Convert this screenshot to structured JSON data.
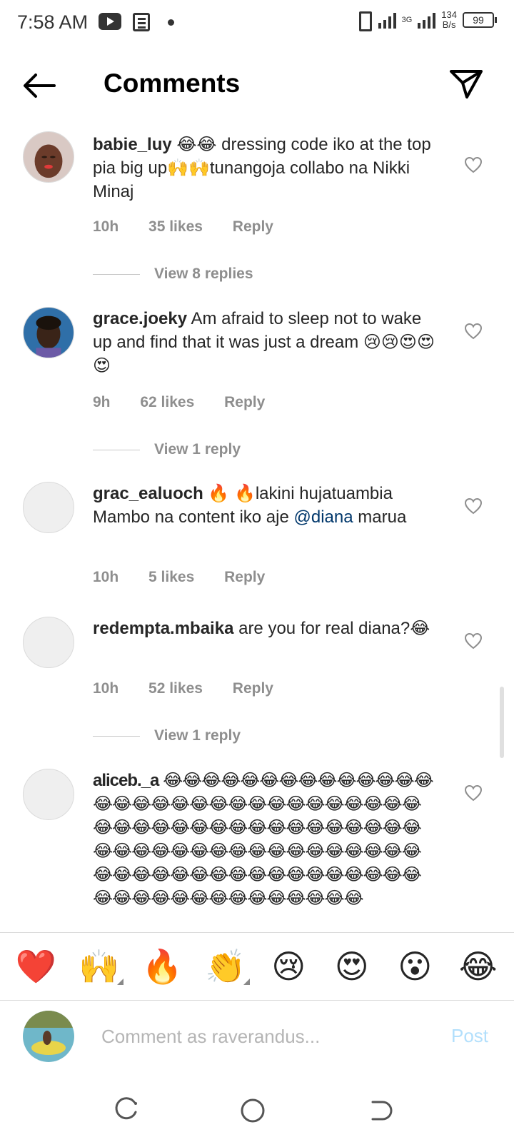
{
  "status_bar": {
    "time": "7:58 AM",
    "network": "3G",
    "speed_value": "134",
    "speed_unit": "B/s",
    "battery": "99"
  },
  "header": {
    "title": "Comments",
    "back_icon": "arrow-left-icon",
    "send_icon": "paper-plane-icon"
  },
  "comments": [
    {
      "username": "babie_luy",
      "text": "😂😂 dressing code iko at the top pia big up🙌🙌tunangoja collabo na Nikki Minaj",
      "time": "10h",
      "likes": "35 likes",
      "reply": "Reply",
      "view_replies": "View 8 replies"
    },
    {
      "username": "grace.joeky",
      "text": "Am afraid to sleep not to wake up and find that it was just a dream 😢😢😍😍😍",
      "time": "9h",
      "likes": "62 likes",
      "reply": "Reply",
      "view_replies": "View 1 reply"
    },
    {
      "username": "grac_ealuoch",
      "text_before": "🔥 🔥lakini hujatuambia Mambo na content iko aje ",
      "mention": "@diana",
      "text_after": " marua",
      "time": "10h",
      "likes": "5 likes",
      "reply": "Reply"
    },
    {
      "username": "redempta.mbaika",
      "text": "are you for real diana?😂",
      "time": "10h",
      "likes": "52 likes",
      "reply": "Reply",
      "view_replies": "View 1 reply"
    },
    {
      "username": "aliceb._a",
      "text": "😂😂😂😂😂😂😂😂😂😂😂😂😂😂😂😂😂😂😂😂😂😂😂😂😂😂😂😂😂😂😂😂😂😂😂😂😂😂😂😂😂😂😂😂😂😂😂😂😂😂😂😂😂😂😂😂😂😂😂😂😂😂😂😂😂😂😂😂😂😂😂😂😂😂😂😂😂😂😂😂😂😂😂😂😂😂😂😂😂😂😂😂😂😂😂😂"
    }
  ],
  "quick_emojis": [
    "❤️",
    "🙌",
    "🔥",
    "👏",
    "😢",
    "😍",
    "😮",
    "😂"
  ],
  "composer": {
    "placeholder": "Comment as raverandus...",
    "post_label": "Post"
  },
  "colors": {
    "meta_gray": "#8e8e8e",
    "mention_blue": "#00376b",
    "post_disabled": "#b2dffc"
  }
}
